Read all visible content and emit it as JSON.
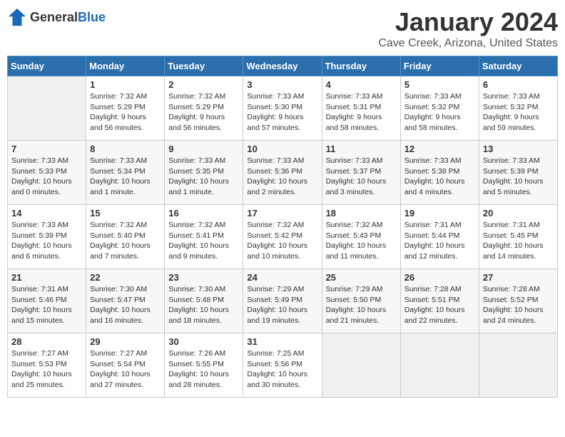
{
  "header": {
    "logo_general": "General",
    "logo_blue": "Blue",
    "month": "January 2024",
    "location": "Cave Creek, Arizona, United States"
  },
  "days_of_week": [
    "Sunday",
    "Monday",
    "Tuesday",
    "Wednesday",
    "Thursday",
    "Friday",
    "Saturday"
  ],
  "weeks": [
    [
      {
        "day": "",
        "empty": true
      },
      {
        "day": "1",
        "sunrise": "Sunrise: 7:32 AM",
        "sunset": "Sunset: 5:29 PM",
        "daylight": "Daylight: 9 hours and 56 minutes."
      },
      {
        "day": "2",
        "sunrise": "Sunrise: 7:32 AM",
        "sunset": "Sunset: 5:29 PM",
        "daylight": "Daylight: 9 hours and 56 minutes."
      },
      {
        "day": "3",
        "sunrise": "Sunrise: 7:33 AM",
        "sunset": "Sunset: 5:30 PM",
        "daylight": "Daylight: 9 hours and 57 minutes."
      },
      {
        "day": "4",
        "sunrise": "Sunrise: 7:33 AM",
        "sunset": "Sunset: 5:31 PM",
        "daylight": "Daylight: 9 hours and 58 minutes."
      },
      {
        "day": "5",
        "sunrise": "Sunrise: 7:33 AM",
        "sunset": "Sunset: 5:32 PM",
        "daylight": "Daylight: 9 hours and 58 minutes."
      },
      {
        "day": "6",
        "sunrise": "Sunrise: 7:33 AM",
        "sunset": "Sunset: 5:32 PM",
        "daylight": "Daylight: 9 hours and 59 minutes."
      }
    ],
    [
      {
        "day": "7",
        "sunrise": "Sunrise: 7:33 AM",
        "sunset": "Sunset: 5:33 PM",
        "daylight": "Daylight: 10 hours and 0 minutes."
      },
      {
        "day": "8",
        "sunrise": "Sunrise: 7:33 AM",
        "sunset": "Sunset: 5:34 PM",
        "daylight": "Daylight: 10 hours and 1 minute."
      },
      {
        "day": "9",
        "sunrise": "Sunrise: 7:33 AM",
        "sunset": "Sunset: 5:35 PM",
        "daylight": "Daylight: 10 hours and 1 minute."
      },
      {
        "day": "10",
        "sunrise": "Sunrise: 7:33 AM",
        "sunset": "Sunset: 5:36 PM",
        "daylight": "Daylight: 10 hours and 2 minutes."
      },
      {
        "day": "11",
        "sunrise": "Sunrise: 7:33 AM",
        "sunset": "Sunset: 5:37 PM",
        "daylight": "Daylight: 10 hours and 3 minutes."
      },
      {
        "day": "12",
        "sunrise": "Sunrise: 7:33 AM",
        "sunset": "Sunset: 5:38 PM",
        "daylight": "Daylight: 10 hours and 4 minutes."
      },
      {
        "day": "13",
        "sunrise": "Sunrise: 7:33 AM",
        "sunset": "Sunset: 5:39 PM",
        "daylight": "Daylight: 10 hours and 5 minutes."
      }
    ],
    [
      {
        "day": "14",
        "sunrise": "Sunrise: 7:33 AM",
        "sunset": "Sunset: 5:39 PM",
        "daylight": "Daylight: 10 hours and 6 minutes."
      },
      {
        "day": "15",
        "sunrise": "Sunrise: 7:32 AM",
        "sunset": "Sunset: 5:40 PM",
        "daylight": "Daylight: 10 hours and 7 minutes."
      },
      {
        "day": "16",
        "sunrise": "Sunrise: 7:32 AM",
        "sunset": "Sunset: 5:41 PM",
        "daylight": "Daylight: 10 hours and 9 minutes."
      },
      {
        "day": "17",
        "sunrise": "Sunrise: 7:32 AM",
        "sunset": "Sunset: 5:42 PM",
        "daylight": "Daylight: 10 hours and 10 minutes."
      },
      {
        "day": "18",
        "sunrise": "Sunrise: 7:32 AM",
        "sunset": "Sunset: 5:43 PM",
        "daylight": "Daylight: 10 hours and 11 minutes."
      },
      {
        "day": "19",
        "sunrise": "Sunrise: 7:31 AM",
        "sunset": "Sunset: 5:44 PM",
        "daylight": "Daylight: 10 hours and 12 minutes."
      },
      {
        "day": "20",
        "sunrise": "Sunrise: 7:31 AM",
        "sunset": "Sunset: 5:45 PM",
        "daylight": "Daylight: 10 hours and 14 minutes."
      }
    ],
    [
      {
        "day": "21",
        "sunrise": "Sunrise: 7:31 AM",
        "sunset": "Sunset: 5:46 PM",
        "daylight": "Daylight: 10 hours and 15 minutes."
      },
      {
        "day": "22",
        "sunrise": "Sunrise: 7:30 AM",
        "sunset": "Sunset: 5:47 PM",
        "daylight": "Daylight: 10 hours and 16 minutes."
      },
      {
        "day": "23",
        "sunrise": "Sunrise: 7:30 AM",
        "sunset": "Sunset: 5:48 PM",
        "daylight": "Daylight: 10 hours and 18 minutes."
      },
      {
        "day": "24",
        "sunrise": "Sunrise: 7:29 AM",
        "sunset": "Sunset: 5:49 PM",
        "daylight": "Daylight: 10 hours and 19 minutes."
      },
      {
        "day": "25",
        "sunrise": "Sunrise: 7:29 AM",
        "sunset": "Sunset: 5:50 PM",
        "daylight": "Daylight: 10 hours and 21 minutes."
      },
      {
        "day": "26",
        "sunrise": "Sunrise: 7:28 AM",
        "sunset": "Sunset: 5:51 PM",
        "daylight": "Daylight: 10 hours and 22 minutes."
      },
      {
        "day": "27",
        "sunrise": "Sunrise: 7:28 AM",
        "sunset": "Sunset: 5:52 PM",
        "daylight": "Daylight: 10 hours and 24 minutes."
      }
    ],
    [
      {
        "day": "28",
        "sunrise": "Sunrise: 7:27 AM",
        "sunset": "Sunset: 5:53 PM",
        "daylight": "Daylight: 10 hours and 25 minutes."
      },
      {
        "day": "29",
        "sunrise": "Sunrise: 7:27 AM",
        "sunset": "Sunset: 5:54 PM",
        "daylight": "Daylight: 10 hours and 27 minutes."
      },
      {
        "day": "30",
        "sunrise": "Sunrise: 7:26 AM",
        "sunset": "Sunset: 5:55 PM",
        "daylight": "Daylight: 10 hours and 28 minutes."
      },
      {
        "day": "31",
        "sunrise": "Sunrise: 7:25 AM",
        "sunset": "Sunset: 5:56 PM",
        "daylight": "Daylight: 10 hours and 30 minutes."
      },
      {
        "day": "",
        "empty": true
      },
      {
        "day": "",
        "empty": true
      },
      {
        "day": "",
        "empty": true
      }
    ]
  ]
}
